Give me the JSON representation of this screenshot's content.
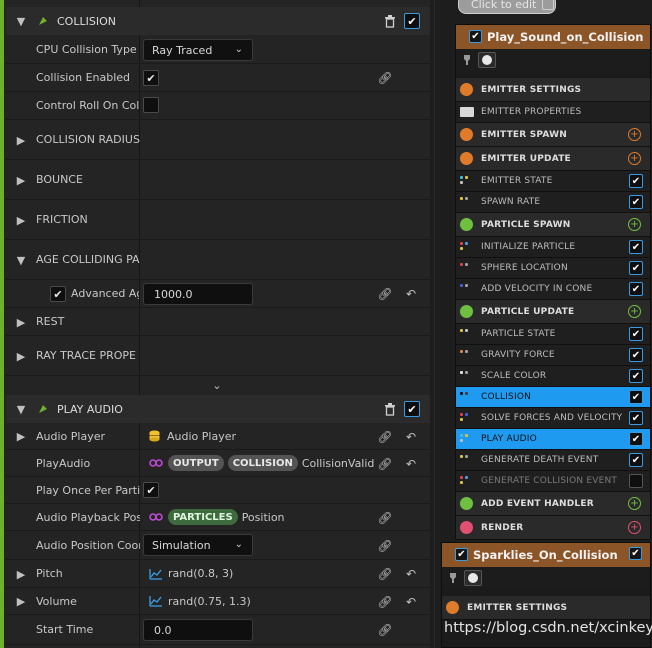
{
  "collision_section": {
    "title": "COLLISION",
    "rows": {
      "cpu_collision_type": {
        "label": "CPU Collision Type",
        "value": "Ray Traced"
      },
      "collision_enabled": {
        "label": "Collision Enabled",
        "checked": true
      },
      "control_roll": {
        "label": "Control Roll On Coll",
        "checked": false
      },
      "collision_radius": {
        "label": "COLLISION RADIUS"
      },
      "bounce": {
        "label": "BOUNCE"
      },
      "friction": {
        "label": "FRICTION"
      },
      "age_colliding": {
        "label": "AGE COLLIDING PAI"
      },
      "advanced": {
        "label": "Advanced Ag",
        "value": "1000.0",
        "checked": true
      },
      "rest": {
        "label": "REST"
      },
      "ray_trace": {
        "label": "RAY TRACE PROPE"
      }
    }
  },
  "play_audio_section": {
    "title": "PLAY AUDIO",
    "rows": {
      "audio_player": {
        "label": "Audio Player",
        "value": "Audio Player"
      },
      "play_audio": {
        "label": "PlayAudio",
        "pill1": "OUTPUT",
        "pill2": "COLLISION",
        "value": "CollisionValid"
      },
      "play_once": {
        "label": "Play Once Per Parti",
        "checked": true
      },
      "playback_pos": {
        "label": "Audio Playback Pos",
        "pill": "PARTICLES",
        "value": "Position"
      },
      "pos_coord": {
        "label": "Audio Position Coor",
        "value": "Simulation"
      },
      "pitch": {
        "label": "Pitch",
        "value": "rand(0.8, 3)"
      },
      "volume": {
        "label": "Volume",
        "value": "rand(0.75, 1.3)"
      },
      "start_time": {
        "label": "Start Time",
        "value": "0.0"
      }
    }
  },
  "graph": {
    "comment_bubble": "Click to edit",
    "node1": {
      "title": "Play_Sound_on_Collision",
      "stack": [
        {
          "kind": "header",
          "label": "EMITTER SETTINGS",
          "icon": "emitter-settings-icon",
          "color": "#e07b2a"
        },
        {
          "kind": "item",
          "label": "EMITTER PROPERTIES",
          "icon": "cpu-icon"
        },
        {
          "kind": "header",
          "label": "EMITTER SPAWN",
          "icon": "spawn-icon",
          "color": "#e07b2a",
          "plus": true
        },
        {
          "kind": "header",
          "label": "EMITTER UPDATE",
          "icon": "update-icon",
          "color": "#e07b2a",
          "plus": true
        },
        {
          "kind": "item",
          "label": "EMITTER STATE",
          "check": true
        },
        {
          "kind": "item",
          "label": "SPAWN RATE",
          "check": true
        },
        {
          "kind": "header",
          "label": "PARTICLE SPAWN",
          "icon": "particle-spawn-icon",
          "color": "#6fc040",
          "plus": true
        },
        {
          "kind": "item",
          "label": "INITIALIZE PARTICLE",
          "check": true
        },
        {
          "kind": "item",
          "label": "SPHERE LOCATION",
          "check": true
        },
        {
          "kind": "item",
          "label": "ADD VELOCITY IN CONE",
          "check": true
        },
        {
          "kind": "header",
          "label": "PARTICLE UPDATE",
          "icon": "particle-update-icon",
          "color": "#6fc040",
          "plus": true
        },
        {
          "kind": "item",
          "label": "PARTICLE STATE",
          "check": true
        },
        {
          "kind": "item",
          "label": "GRAVITY FORCE",
          "check": true
        },
        {
          "kind": "item",
          "label": "SCALE COLOR",
          "check": true
        },
        {
          "kind": "sel",
          "label": "COLLISION",
          "check": true
        },
        {
          "kind": "item",
          "label": "SOLVE FORCES AND VELOCITY",
          "check": true
        },
        {
          "kind": "sel",
          "label": "PLAY AUDIO",
          "check": true
        },
        {
          "kind": "item",
          "label": "GENERATE DEATH EVENT",
          "check": true
        },
        {
          "kind": "item",
          "label": "GENERATE COLLISION EVENT",
          "check": false
        },
        {
          "kind": "header",
          "label": "ADD EVENT HANDLER",
          "icon": "event-handler-icon",
          "color": "#6fc040",
          "plus": true
        },
        {
          "kind": "header",
          "label": "RENDER",
          "icon": "render-icon",
          "color": "#e05070",
          "plus": true
        }
      ]
    },
    "node2": {
      "title": "Sparklies_On_Collision",
      "stack": [
        {
          "kind": "header",
          "label": "EMITTER SETTINGS",
          "icon": "emitter-settings-icon",
          "color": "#e07b2a"
        }
      ]
    },
    "watermark": "https://blog.csdn.net/xcinkey"
  }
}
